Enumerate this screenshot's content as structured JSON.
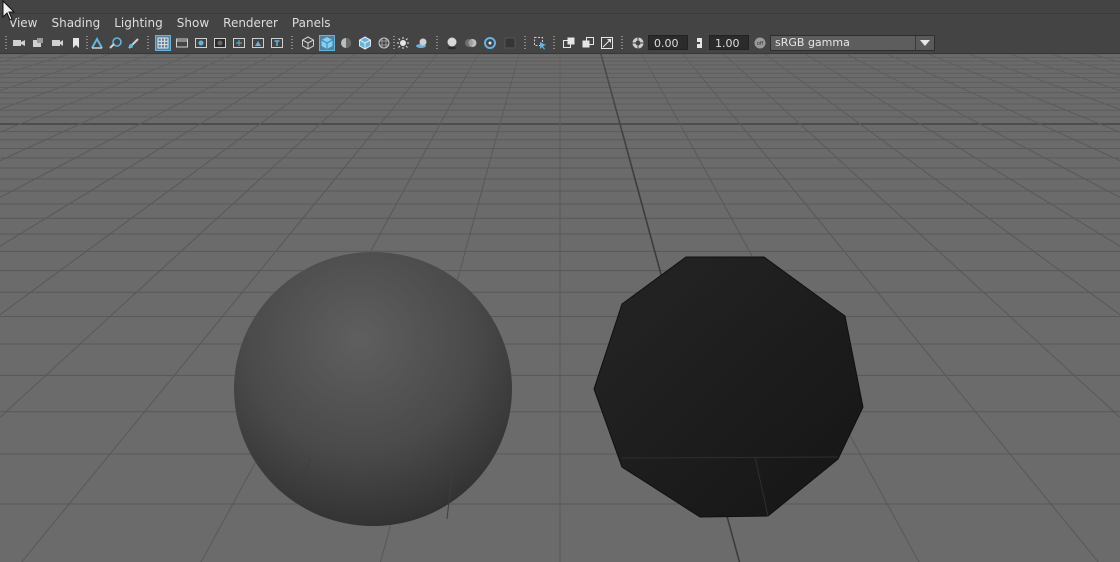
{
  "menu": {
    "items": [
      {
        "label": "View"
      },
      {
        "label": "Shading"
      },
      {
        "label": "Lighting"
      },
      {
        "label": "Show"
      },
      {
        "label": "Renderer"
      },
      {
        "label": "Panels"
      }
    ]
  },
  "toolbar": {
    "exposure_value": "0.00",
    "gamma_value": "1.00",
    "color_space": "sRGB gamma",
    "icons": [
      "select-camera-icon",
      "camera-attributes-icon",
      "bookmarks-icon",
      "bookmark-icon",
      "image-plane-icon",
      "2d-pan-zoom-icon",
      "grease-pencil-icon",
      "grid-icon",
      "film-gate-icon",
      "resolution-gate-icon",
      "gate-mask-icon",
      "field-chart-icon",
      "safe-action-icon",
      "safe-title-icon",
      "wireframe-icon",
      "smooth-shade-icon",
      "use-default-material-icon",
      "wireframe-on-shaded-icon",
      "xray-icon",
      "use-all-lights-icon",
      "shadows-icon",
      "screen-space-ao-icon",
      "motion-blur-icon",
      "multisample-aa-icon",
      "depth-of-field-icon",
      "isolate-select-icon",
      "xray-joints-icon",
      "xray-active-icon",
      "backface-culling-icon",
      "exposure-icon",
      "gamma-icon",
      "color-management-icon",
      "color-space-dropdown-icon"
    ]
  },
  "colors": {
    "menubar_bg": "#444444",
    "accent_blue": "#5fb6e0",
    "viewport_bg": "#6b6b6b",
    "grid_line": "#5a5a5a",
    "grid_axis": "#3a3a3a"
  }
}
